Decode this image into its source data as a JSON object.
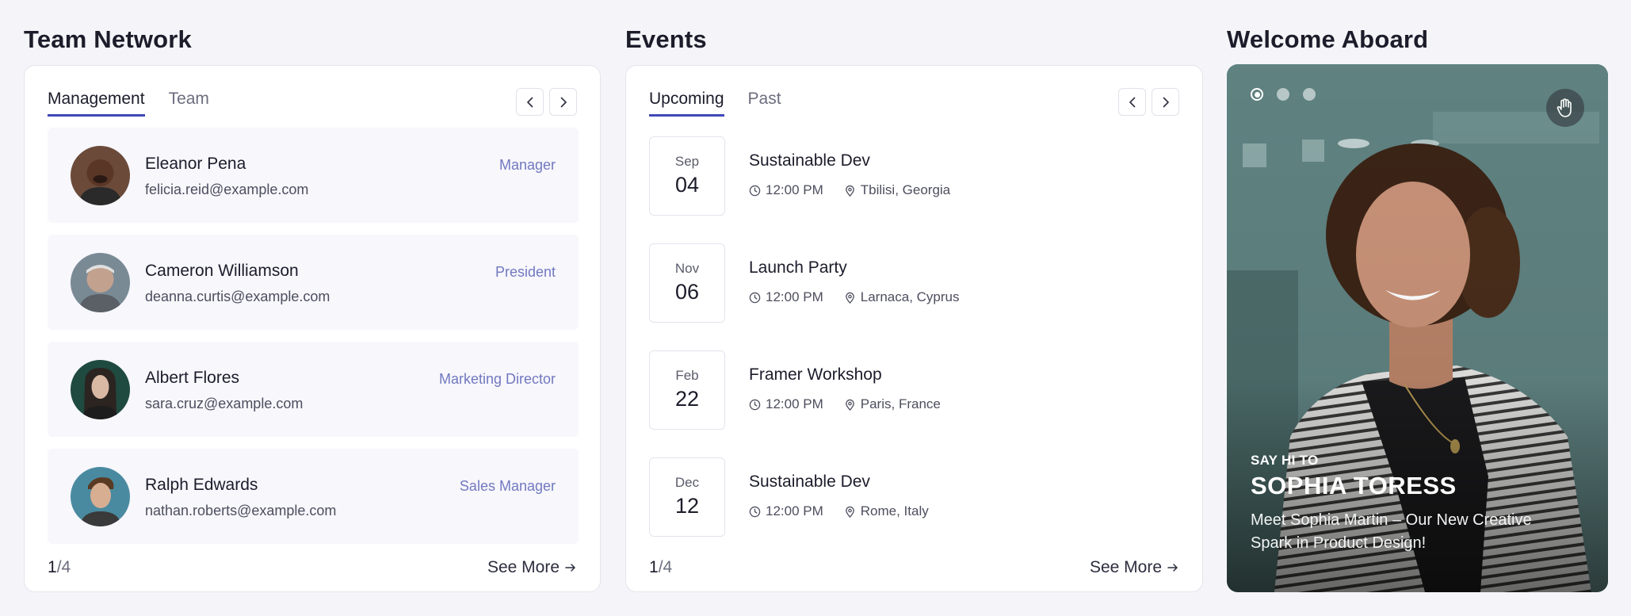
{
  "team_network": {
    "title": "Team Network",
    "tabs": [
      {
        "label": "Management",
        "active": true
      },
      {
        "label": "Team",
        "active": false
      }
    ],
    "members": [
      {
        "name": "Eleanor Pena",
        "email": "felicia.reid@example.com",
        "role": "Manager"
      },
      {
        "name": "Cameron Williamson",
        "email": "deanna.curtis@example.com",
        "role": "President"
      },
      {
        "name": "Albert Flores",
        "email": "sara.cruz@example.com",
        "role": "Marketing Director"
      },
      {
        "name": "Ralph Edwards",
        "email": "nathan.roberts@example.com",
        "role": "Sales Manager"
      }
    ],
    "pager": {
      "current": "1",
      "total": "/4"
    },
    "see_more": "See More"
  },
  "events": {
    "title": "Events",
    "tabs": [
      {
        "label": "Upcoming",
        "active": true
      },
      {
        "label": "Past",
        "active": false
      }
    ],
    "items": [
      {
        "month": "Sep",
        "day": "04",
        "title": "Sustainable Dev",
        "time": "12:00 PM",
        "location": "Tbilisi, Georgia"
      },
      {
        "month": "Nov",
        "day": "06",
        "title": "Launch Party",
        "time": "12:00 PM",
        "location": "Larnaca, Cyprus"
      },
      {
        "month": "Feb",
        "day": "22",
        "title": "Framer Workshop",
        "time": "12:00 PM",
        "location": "Paris, France"
      },
      {
        "month": "Dec",
        "day": "12",
        "title": "Sustainable Dev",
        "time": "12:00 PM",
        "location": "Rome, Italy"
      }
    ],
    "pager": {
      "current": "1",
      "total": "/4"
    },
    "see_more": "See More"
  },
  "welcome": {
    "title": "Welcome Aboard",
    "slides": 3,
    "active_slide": 1,
    "say_hi": "SAY HI TO",
    "name": "SOPHIA TORESS",
    "description": "Meet Sophia Martin – Our New Creative Spark in Product Design!",
    "wave_icon": "waving-hand-icon"
  },
  "colors": {
    "accent": "#3f48b7",
    "role_text": "#7278c0",
    "page_bg": "#f5f5f9"
  }
}
